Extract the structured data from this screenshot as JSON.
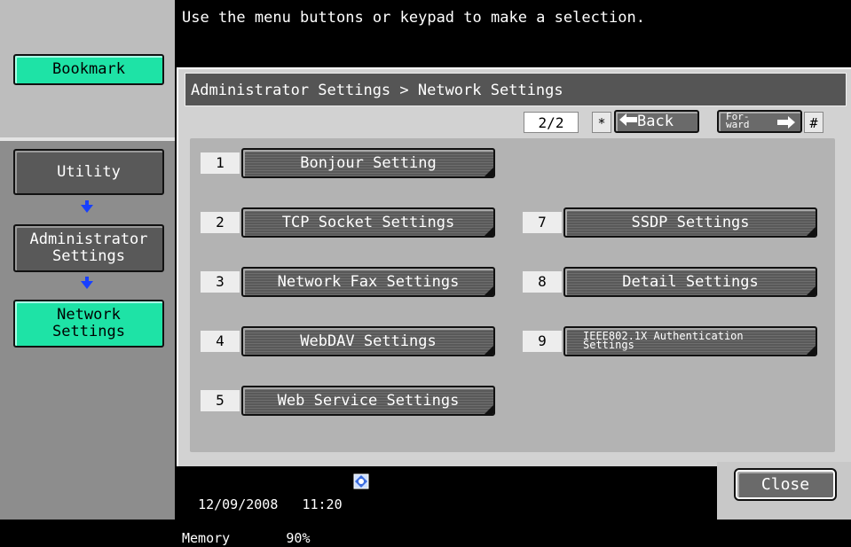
{
  "instruction": "Use the menu buttons or keypad to make a selection.",
  "sidebar": {
    "bookmark_label": "Bookmark",
    "items": [
      {
        "label": "Utility"
      },
      {
        "label": "Administrator\nSettings"
      },
      {
        "label": "Network\nSettings"
      }
    ]
  },
  "breadcrumb": "Administrator Settings > Network Settings",
  "pager": {
    "page": "2/2",
    "back_key": "*",
    "back_label": "Back",
    "forward_label": "For-\nward",
    "forward_key": "#"
  },
  "menu": {
    "items": [
      {
        "num": "1",
        "label": "Bonjour Setting"
      },
      {
        "num": "2",
        "label": "TCP Socket Settings"
      },
      {
        "num": "3",
        "label": "Network Fax Settings"
      },
      {
        "num": "4",
        "label": "WebDAV Settings"
      },
      {
        "num": "5",
        "label": "Web Service Settings"
      },
      {
        "num": "7",
        "label": "SSDP Settings"
      },
      {
        "num": "8",
        "label": "Detail Settings"
      },
      {
        "num": "9",
        "label": "IEEE802.1X Authentication\nSettings"
      }
    ]
  },
  "status": {
    "date": "12/09/2008",
    "time": "11:20",
    "memory_label": "Memory",
    "memory_value": "90%",
    "network_icon": "network-status-icon"
  },
  "close_label": "Close",
  "colors": {
    "accent_green": "#1ee3a6",
    "arrow_blue": "#1840ff",
    "button_gray": "#595959"
  }
}
